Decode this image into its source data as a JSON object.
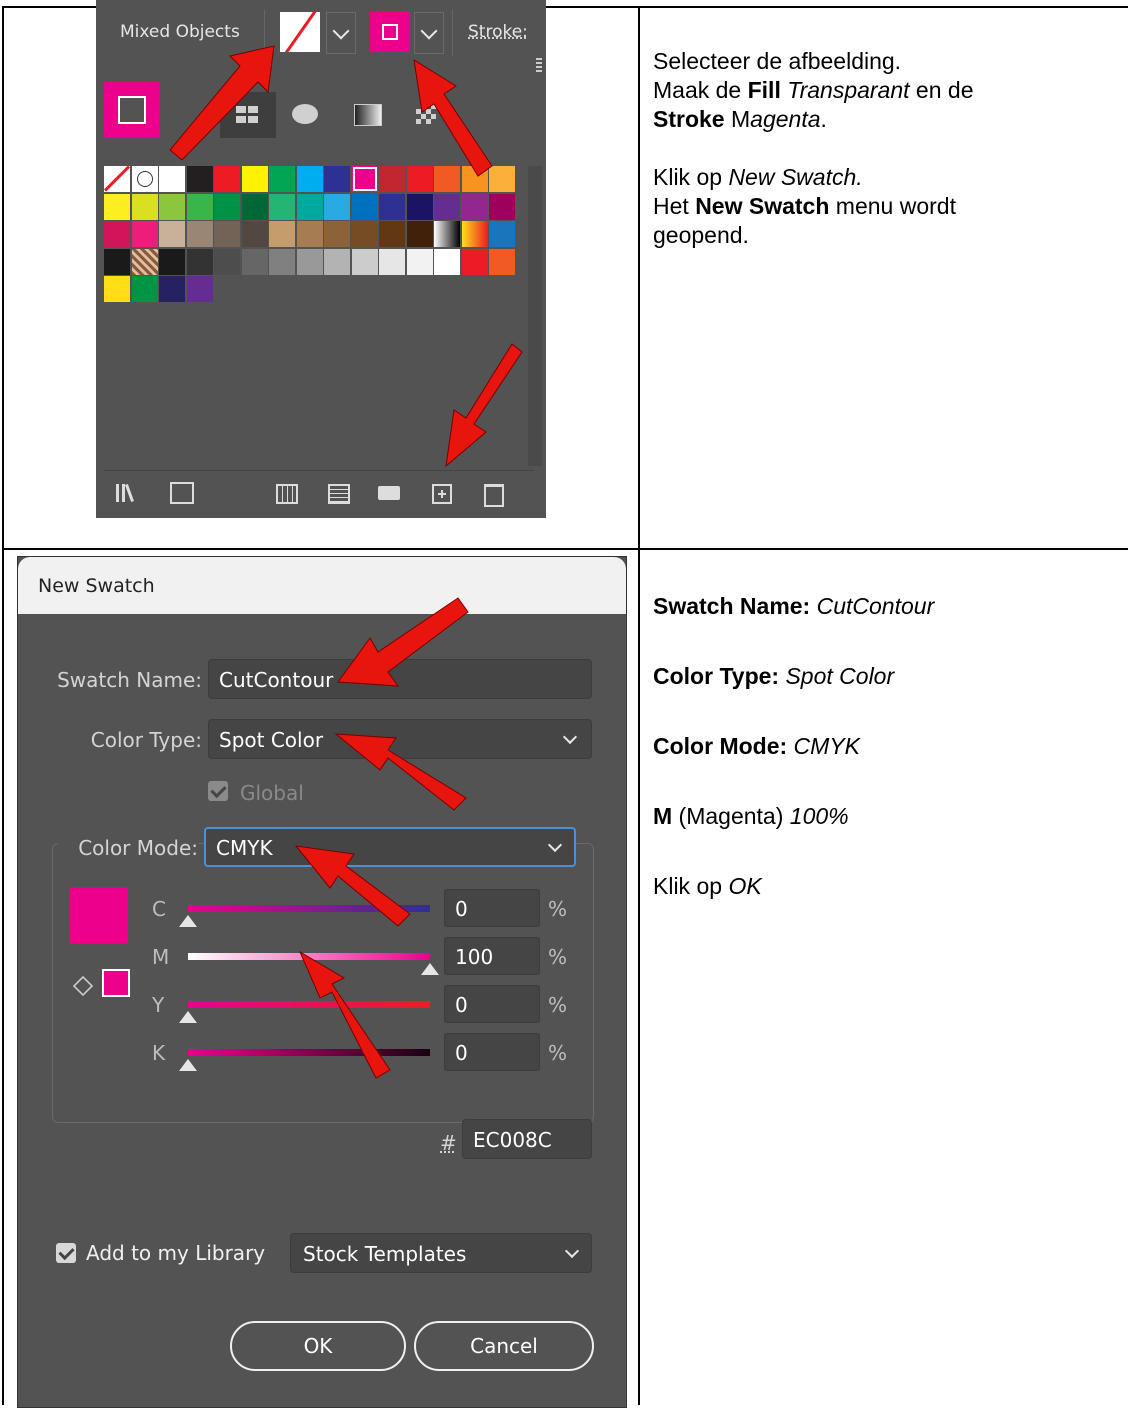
{
  "swatches_panel": {
    "tab_label": "Mixed Objects",
    "stroke_label": "Stroke:",
    "colors": {
      "magenta": "#EC008C",
      "panel_bg": "#535353",
      "arrow_red": "#e8140e"
    },
    "grid": [
      [
        "none",
        "registration",
        "#ffffff",
        "#231f20",
        "#ed1c24",
        "#fff200",
        "#00a651",
        "#00aeef",
        "#2e3192",
        "#ec008c",
        "#c1272d",
        "#ed1c24",
        "#f15a24",
        "#f7931e",
        "#fbb03b"
      ],
      [
        "#fcee21",
        "#d9e021",
        "#8cc63f",
        "#39b54a",
        "#009245",
        "#006837",
        "#22b573",
        "#00a99d",
        "#29abe2",
        "#0071bc",
        "#2e3192",
        "#1b1464",
        "#662d91",
        "#93278f",
        "#9e005d"
      ],
      [
        "#d4145a",
        "#ed1e79",
        "#c7b299",
        "#998675",
        "#736357",
        "#534741",
        "#c69c6d",
        "#a67c52",
        "#8c6239",
        "#754c24",
        "#603813",
        "#42210b",
        "gradient-bw",
        "gradient-orange",
        "#1b75bc"
      ],
      [
        "#1a1a1a",
        "pattern",
        "#1a1a1a",
        "#333333",
        "#4d4d4d",
        "#666666",
        "#808080",
        "#999999",
        "#b3b3b3",
        "#cccccc",
        "#e6e6e6",
        "#f2f2f2",
        "#ffffff",
        "#ed1c24",
        "#f15a24"
      ],
      [
        "#ffde17",
        "#009444",
        "#262262",
        "#662d91"
      ]
    ],
    "bottom_icons": [
      "libraries-icon",
      "place-icon",
      "show-kinds-icon",
      "swatch-options-icon",
      "new-group-icon",
      "new-swatch-icon",
      "delete-icon"
    ]
  },
  "instructions_top": {
    "line1": "Selecteer de afbeelding.",
    "line2_a": "Maak de ",
    "line2_b": "Fill",
    "line2_c": " ",
    "line2_d": "Transparant",
    "line2_e": " en de",
    "line3_a": "Stroke",
    "line3_b": " M",
    "line3_c": "agenta",
    "line3_d": ".",
    "line4_a": "Klik op ",
    "line4_b": "New Swatch.",
    "line5_a": "Het ",
    "line5_b": "New Swatch",
    "line5_c": " menu wordt",
    "line6": "geopend."
  },
  "dialog": {
    "title": "New Swatch",
    "swatch_name_label": "Swatch Name:",
    "swatch_name_value": "CutContour",
    "color_type_label": "Color Type:",
    "color_type_value": "Spot Color",
    "global_label": "Global",
    "global_checked": true,
    "color_mode_label": "Color Mode:",
    "color_mode_value": "CMYK",
    "sliders": [
      {
        "label": "C",
        "value": "0",
        "pct": "%",
        "level": 0
      },
      {
        "label": "M",
        "value": "100",
        "pct": "%",
        "level": 1
      },
      {
        "label": "Y",
        "value": "0",
        "pct": "%",
        "level": 0
      },
      {
        "label": "K",
        "value": "0",
        "pct": "%",
        "level": 0
      }
    ],
    "hash_label": "#",
    "hex_value": "EC008C",
    "add_library_label": "Add to my Library",
    "add_library_checked": true,
    "library_select": "Stock Templates",
    "ok_label": "OK",
    "cancel_label": "Cancel",
    "swatch_color": "#EC008C"
  },
  "instructions_bottom": {
    "name_label": "Swatch Name:",
    "name_value": "CutContour",
    "type_label": "Color Type:",
    "type_value": "Spot Color",
    "mode_label": "Color Mode:",
    "mode_value": "CMYK",
    "m_label": "M",
    "m_desc": " (Magenta) ",
    "m_value": "100%",
    "ok_text_a": "Klik op ",
    "ok_text_b": "OK"
  }
}
